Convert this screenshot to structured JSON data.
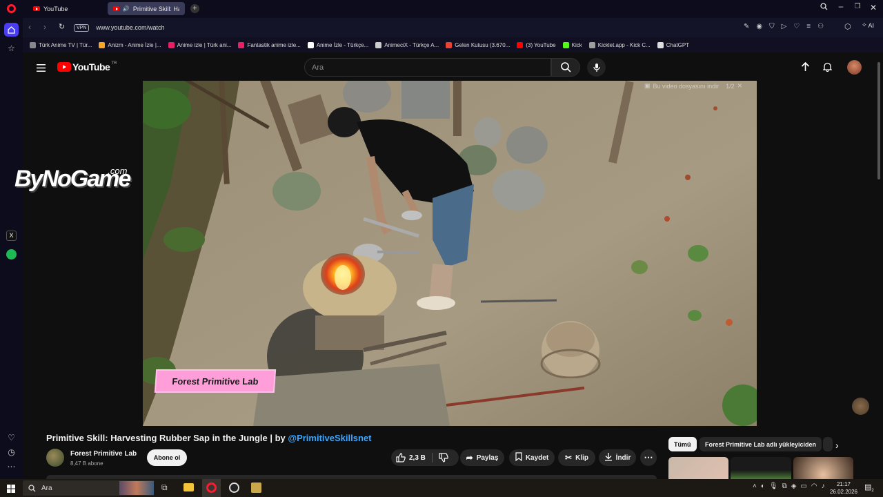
{
  "browser": {
    "tabs": [
      {
        "label": "YouTube",
        "active": false
      },
      {
        "label": "Primitive Skill: Harvest",
        "active": true
      }
    ],
    "url": "www.youtube.com/watch",
    "vpn_label": "VPN",
    "ai_label": "AI",
    "bookmarks": [
      {
        "label": "Türk Anime TV | Tür...",
        "color": "#888888"
      },
      {
        "label": "Anizm - Anime İzle |...",
        "color": "#f5a623"
      },
      {
        "label": "Anime izle | Türk ani...",
        "color": "#e91e63"
      },
      {
        "label": "Fantastik anime izle...",
        "color": "#e91e63"
      },
      {
        "label": "Anime İzle - Türkçe...",
        "color": "#ffffff"
      },
      {
        "label": "AnimeciX - Türkçe A...",
        "color": "#cccccc"
      },
      {
        "label": "Gelen Kutusu (3.670...",
        "color": "#ea4335"
      },
      {
        "label": "(3) YouTube",
        "color": "#ff0000"
      },
      {
        "label": "Kick",
        "color": "#53fc18"
      },
      {
        "label": "Kicklet.app - Kick C...",
        "color": "#9e9e9e"
      },
      {
        "label": "ChatGPT",
        "color": "#dddddd"
      }
    ]
  },
  "youtube": {
    "logo_text": "YouTube",
    "country_code": "TR",
    "search_placeholder": "Ara"
  },
  "video": {
    "watermark_left": "ByNoGame",
    "watermark_left_suffix": ".com",
    "download_hint": "Bu video dosyasını indir",
    "download_hint_count": "1/2",
    "overlay_label": "Forest Primitive Lab",
    "title": "Primitive Skill: Harvesting Rubber Sap in the Jungle | by ",
    "title_link": "@PrimitiveSkillsnet",
    "channel_name": "Forest Primitive Lab",
    "subscribers": "8,47 B abone",
    "subscribe_label": "Abone ol",
    "like_count": "2,3 B",
    "share_label": "Paylaş",
    "save_label": "Kaydet",
    "clip_label": "Klip",
    "download_label": "İndir"
  },
  "filters": {
    "chips": [
      "Tümü",
      "Forest Primitive Lab adlı yükleyiciden"
    ]
  },
  "taskbar": {
    "search_placeholder": "Ara",
    "time": "21:17",
    "date": "26.02.2026",
    "notification_count": "2"
  },
  "colors": {
    "youtube_red": "#ff0000",
    "link_blue": "#3ea6ff",
    "opera_red": "#ff1b2d",
    "overlay_pink": "#ff9ed8"
  }
}
